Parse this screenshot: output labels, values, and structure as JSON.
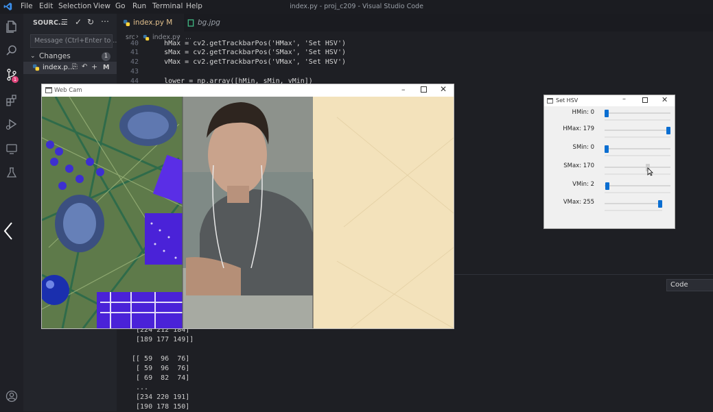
{
  "menubar": [
    "File",
    "Edit",
    "Selection",
    "View",
    "Go",
    "Run",
    "Terminal",
    "Help"
  ],
  "window_title": "index.py - proj_c209 - Visual Studio Code",
  "source_control": {
    "title": "SOURC...",
    "message_placeholder": "Message (Ctrl+Enter to ...",
    "changes_label": "Changes",
    "changes_count": "1",
    "file_name": "index.p...",
    "file_status": "M",
    "badge_count": "1"
  },
  "tabs": [
    {
      "label": "index.py M"
    },
    {
      "label": "bg.jpg"
    }
  ],
  "breadcrumb": {
    "folder": "src",
    "file": "index.py",
    "more": "..."
  },
  "code_lines": [
    {
      "num": "40",
      "text": "    hMax = cv2.getTrackbarPos('HMax', 'Set HSV')"
    },
    {
      "num": "41",
      "text": "    sMax = cv2.getTrackbarPos('SMax', 'Set HSV')"
    },
    {
      "num": "42",
      "text": "    vMax = cv2.getTrackbarPos('VMax', 'Set HSV')"
    },
    {
      "num": "43",
      "text": ""
    },
    {
      "num": "44",
      "text": "    lower = np.array([hMin, sMin, vMin])"
    }
  ],
  "panel_dropdown": "Code",
  "terminal_lines": [
    " [224 212 184]",
    " [189 177 149]]",
    "",
    "[[ 59  96  76]",
    " [ 59  96  76]",
    " [ 69  82  74]",
    " ...",
    " [234 220 191]",
    " [190 178 150]"
  ],
  "webcam": {
    "title": "Web Cam"
  },
  "hsv": {
    "title": "Set HSV",
    "sliders": [
      {
        "label": "HMin: 0",
        "fraction": 0.0
      },
      {
        "label": "HMax: 179",
        "fraction": 1.0
      },
      {
        "label": "SMin: 0",
        "fraction": 0.0
      },
      {
        "label": "SMax: 170",
        "fraction": 0.667
      },
      {
        "label": "VMin: 2",
        "fraction": 0.008
      },
      {
        "label": "VMax: 255",
        "fraction": 1.0
      }
    ]
  },
  "colors": {
    "accent": "#0a6ed1",
    "vscode_blue": "#3b8eea",
    "badge": "#e0457b"
  }
}
